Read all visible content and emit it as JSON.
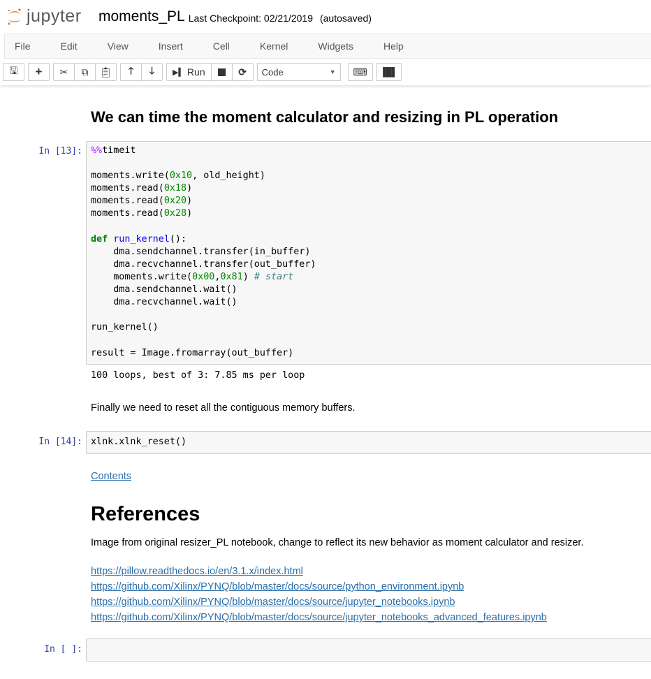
{
  "header": {
    "logo_text": "jupyter",
    "notebook_name": "moments_PL",
    "checkpoint": "Last Checkpoint: 02/21/2019",
    "autosave": "(autosaved)"
  },
  "menu": [
    "File",
    "Edit",
    "View",
    "Insert",
    "Cell",
    "Kernel",
    "Widgets",
    "Help"
  ],
  "toolbar": {
    "run_label": "Run",
    "cell_type": "Code"
  },
  "cells": {
    "heading1": "We can time the moment calculator and resizing in PL operation",
    "prompt13": "In [13]:",
    "code13": [
      [
        [
          "%%",
          "mg"
        ],
        [
          "timeit",
          ""
        ]
      ],
      [],
      [
        [
          "moments.write(",
          ""
        ],
        [
          "0x10",
          "num"
        ],
        [
          ", old_height)",
          ""
        ]
      ],
      [
        [
          "moments.read(",
          ""
        ],
        [
          "0x18",
          "num"
        ],
        [
          ")",
          ""
        ]
      ],
      [
        [
          "moments.read(",
          ""
        ],
        [
          "0x20",
          "num"
        ],
        [
          ")",
          ""
        ]
      ],
      [
        [
          "moments.read(",
          ""
        ],
        [
          "0x28",
          "num"
        ],
        [
          ")",
          ""
        ]
      ],
      [],
      [
        [
          "def",
          "kw"
        ],
        [
          " ",
          ""
        ],
        [
          "run_kernel",
          "fn"
        ],
        [
          "():",
          ""
        ]
      ],
      [
        [
          "    dma.sendchannel.transfer(in_buffer)",
          ""
        ]
      ],
      [
        [
          "    dma.recvchannel.transfer(out_buffer)",
          ""
        ]
      ],
      [
        [
          "    moments.write(",
          ""
        ],
        [
          "0x00",
          "num"
        ],
        [
          ",",
          ""
        ],
        [
          "0x81",
          "num"
        ],
        [
          ") ",
          ""
        ],
        [
          "# start",
          "cm"
        ]
      ],
      [
        [
          "    dma.sendchannel.wait()",
          ""
        ]
      ],
      [
        [
          "    dma.recvchannel.wait()",
          ""
        ]
      ],
      [],
      [
        [
          "run_kernel()",
          ""
        ]
      ],
      [],
      [
        [
          "result = Image.fromarray(out_buffer)",
          ""
        ]
      ]
    ],
    "output13": "100 loops, best of 3: 7.85 ms per loop",
    "reset_text": "Finally we need to reset all the contiguous memory buffers.",
    "prompt14": "In [14]:",
    "code14": "xlnk.xlnk_reset()",
    "contents_link": "Contents",
    "references_heading": "References",
    "references_text": "Image from original resizer_PL notebook, change to reflect its new behavior as moment calculator and resizer.",
    "links": [
      "https://pillow.readthedocs.io/en/3.1.x/index.html",
      "https://github.com/Xilinx/PYNQ/blob/master/docs/source/python_environment.ipynb",
      "https://github.com/Xilinx/PYNQ/blob/master/docs/source/jupyter_notebooks.ipynb",
      "https://github.com/Xilinx/PYNQ/blob/master/docs/source/jupyter_notebooks_advanced_features.ipynb"
    ],
    "prompt_empty": "In [ ]:"
  }
}
